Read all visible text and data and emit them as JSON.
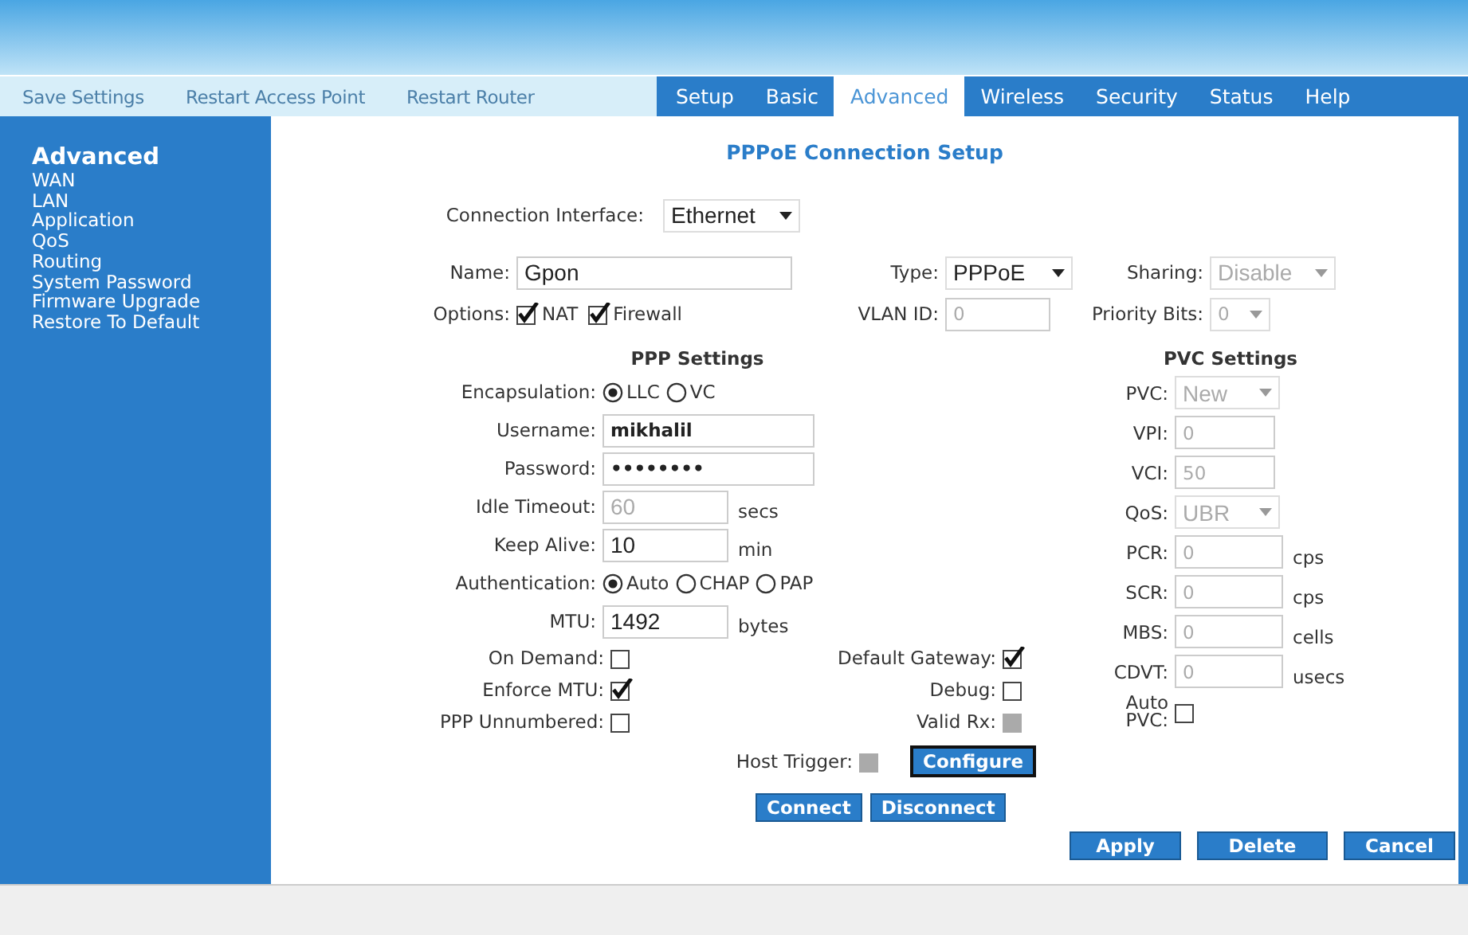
{
  "actions": [
    "Save Settings",
    "Restart Access Point",
    "Restart Router"
  ],
  "tabs": [
    {
      "label": "Setup",
      "selected": false
    },
    {
      "label": "Basic",
      "selected": false
    },
    {
      "label": "Advanced",
      "selected": true
    },
    {
      "label": "Wireless",
      "selected": false
    },
    {
      "label": "Security",
      "selected": false
    },
    {
      "label": "Status",
      "selected": false
    },
    {
      "label": "Help",
      "selected": false
    }
  ],
  "sidebar": {
    "title": "Advanced",
    "items": [
      "WAN",
      "LAN",
      "Application",
      "QoS",
      "Routing",
      "System Password",
      "Firmware Upgrade",
      "Restore To Default"
    ]
  },
  "page_title": "PPPoE Connection Setup",
  "connection_interface": {
    "label": "Connection Interface:",
    "value": "Ethernet"
  },
  "name": {
    "label": "Name:",
    "value": "Gpon"
  },
  "type": {
    "label": "Type:",
    "value": "PPPoE"
  },
  "sharing": {
    "label": "Sharing:",
    "value": "Disable",
    "disabled": true
  },
  "options": {
    "label": "Options:",
    "items": [
      {
        "label": "NAT",
        "checked": true
      },
      {
        "label": "Firewall",
        "checked": true
      }
    ]
  },
  "vlan_id": {
    "label": "VLAN ID:",
    "value": "0",
    "disabled": true
  },
  "priority_bits": {
    "label": "Priority Bits:",
    "value": "0",
    "disabled": true
  },
  "ppp": {
    "heading": "PPP Settings",
    "rows": [
      {
        "kind": "radio",
        "label": "Encapsulation:",
        "options": [
          {
            "label": "LLC",
            "selected": true
          },
          {
            "label": "VC",
            "selected": false
          }
        ]
      },
      {
        "kind": "text",
        "label": "Username:",
        "value": "mikhalil",
        "bold": true
      },
      {
        "kind": "text",
        "label": "Password:",
        "value": "••••••••",
        "bold": true
      },
      {
        "kind": "text",
        "label": "Idle Timeout:",
        "value": "60",
        "disabled": true,
        "unit": "secs"
      },
      {
        "kind": "text",
        "label": "Keep Alive:",
        "value": "10",
        "unit": "min"
      },
      {
        "kind": "radio",
        "label": "Authentication:",
        "options": [
          {
            "label": "Auto",
            "selected": true
          },
          {
            "label": "CHAP",
            "selected": false
          },
          {
            "label": "PAP",
            "selected": false
          }
        ]
      },
      {
        "kind": "text",
        "label": "MTU:",
        "value": "1492",
        "unit": "bytes"
      }
    ]
  },
  "flags": [
    {
      "label": "On Demand:",
      "checked": false
    },
    {
      "label": "Default Gateway:",
      "checked": true
    },
    {
      "label": "Enforce MTU:",
      "checked": true
    },
    {
      "label": "Debug:",
      "checked": false
    },
    {
      "label": "PPP Unnumbered:",
      "checked": false
    },
    {
      "label": "Valid Rx:",
      "checked": false,
      "disabled": true
    }
  ],
  "host_trigger": {
    "label": "Host Trigger:",
    "checked": false,
    "disabled": true,
    "button": "Configure"
  },
  "connect_buttons": [
    "Connect",
    "Disconnect"
  ],
  "pvc": {
    "heading": "PVC Settings",
    "rows": [
      {
        "kind": "select",
        "label": "PVC:",
        "value": "New",
        "disabled": true
      },
      {
        "kind": "text",
        "label": "VPI:",
        "value": "0",
        "disabled": true
      },
      {
        "kind": "text",
        "label": "VCI:",
        "value": "50",
        "disabled": true
      },
      {
        "kind": "select",
        "label": "QoS:",
        "value": "UBR",
        "disabled": true
      },
      {
        "kind": "text",
        "label": "PCR:",
        "value": "0",
        "disabled": true,
        "unit": "cps"
      },
      {
        "kind": "text",
        "label": "SCR:",
        "value": "0",
        "disabled": true,
        "unit": "cps"
      },
      {
        "kind": "text",
        "label": "MBS:",
        "value": "0",
        "disabled": true,
        "unit": "cells"
      },
      {
        "kind": "text",
        "label": "CDVT:",
        "value": "0",
        "disabled": true,
        "unit": "usecs"
      },
      {
        "kind": "checkbox",
        "label": "Auto PVC:",
        "checked": false
      }
    ]
  },
  "footer_buttons": [
    "Apply",
    "Delete",
    "Cancel"
  ]
}
